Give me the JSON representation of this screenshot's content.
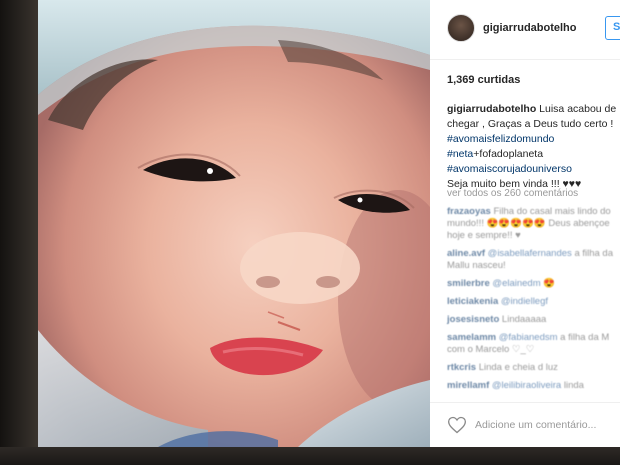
{
  "post": {
    "username": "gigiarrudabotelho",
    "follow_label": "S",
    "likes": "1,369 curtidas",
    "caption": {
      "user": "gigiarrudabotelho",
      "line1": "Luisa acabou de",
      "line2": "chegar , Graças a Deus tudo certo !",
      "tag1": "#avomaisfelizdomundo",
      "tag2": "#neta",
      "tag2_rest": "+fofadoplaneta",
      "tag3": "#avomaiscorujadouniverso",
      "line_last": "Seja muito bem vinda !!! ♥♥♥"
    },
    "view_all": "ver todos os 260 comentários"
  },
  "comments": [
    {
      "user": "frazaoyas",
      "lines": [
        "Filha do casal mais lindo do",
        "mundo!!! 😍😍😍😍😍 Deus abençoe",
        "hoje e sempre!! ♥"
      ]
    },
    {
      "user": "aline.avf",
      "mention": "@isabellafernandes",
      "text": "a filha da",
      "line2": "Mallu nasceu!"
    },
    {
      "user": "smilerbre",
      "mention": "@elainedm",
      "text": "😍"
    },
    {
      "user": "leticiakenia",
      "mention": "@indiellegf",
      "text": ""
    },
    {
      "user": "josesisneto",
      "text": "Lindaaaaa"
    },
    {
      "user": "samelamm",
      "mention": "@fabianedsm",
      "text": "a filha da M",
      "line2": "com o Marcelo ♡_♡"
    },
    {
      "user": "rtkcris",
      "text": "Linda e cheia d luz"
    },
    {
      "user": "mirellamf",
      "mention": "@leilibiraoliveira",
      "text": "linda"
    }
  ],
  "comment_input": {
    "placeholder": "Adicione um comentário..."
  },
  "colors": {
    "link": "#003569",
    "follow": "#3897f0",
    "text": "#262626",
    "muted": "#999999"
  }
}
